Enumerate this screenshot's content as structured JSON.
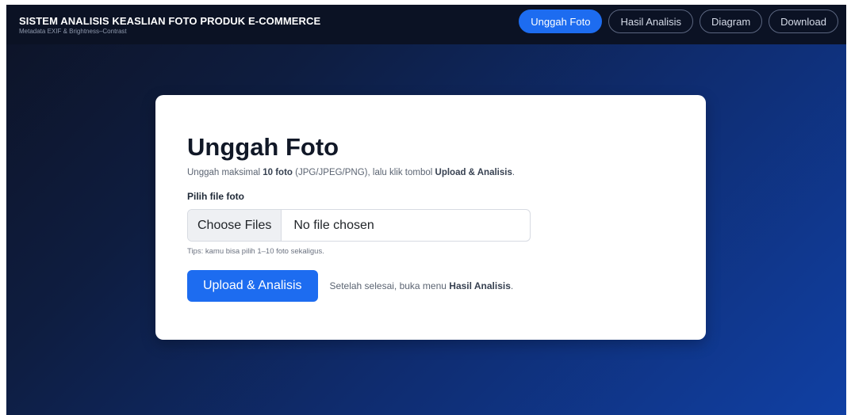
{
  "header": {
    "title": "SISTEM ANALISIS KEASLIAN FOTO PRODUK E-COMMERCE",
    "subtitle": "Metadata EXIF & Brightness–Contrast"
  },
  "nav": [
    {
      "label": "Unggah Foto",
      "active": true
    },
    {
      "label": "Hasil Analisis",
      "active": false
    },
    {
      "label": "Diagram",
      "active": false
    },
    {
      "label": "Download",
      "active": false
    }
  ],
  "main": {
    "title": "Unggah Foto",
    "desc_prefix": "Unggah maksimal ",
    "desc_bold1": "10 foto",
    "desc_middle": " (JPG/JPEG/PNG), lalu klik tombol ",
    "desc_bold2": "Upload & Analisis",
    "desc_suffix": ".",
    "field_label": "Pilih file foto",
    "file_button": "Choose Files",
    "file_status": "No file chosen",
    "tips": "Tips: kamu bisa pilih 1–10 foto sekaligus.",
    "submit_label": "Upload & Analisis",
    "after_prefix": "Setelah selesai, buka menu ",
    "after_bold": "Hasil Analisis",
    "after_suffix": "."
  },
  "colors": {
    "accent": "#1d6cf0",
    "navbar": "#0b1224",
    "background_start": "#0d1326",
    "background_end": "#1040a4"
  }
}
